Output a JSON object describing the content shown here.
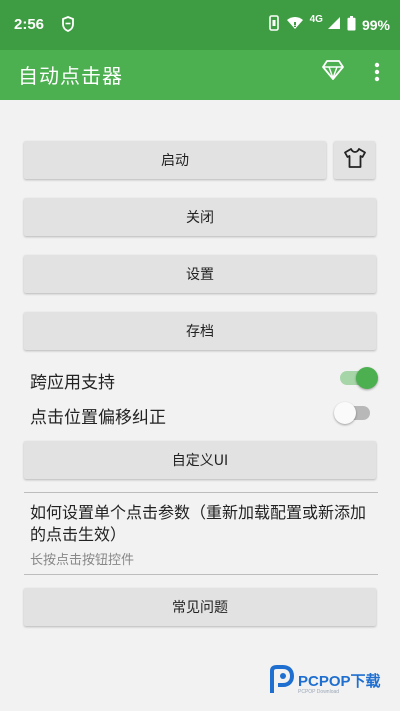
{
  "status_bar": {
    "time": "2:56",
    "network": "4G",
    "battery": "99%"
  },
  "app_bar": {
    "title": "自动点击器",
    "vip_icon": "diamond-icon",
    "menu_icon": "more-vert-icon"
  },
  "buttons": {
    "start": "启动",
    "stop": "关闭",
    "settings": "设置",
    "archive": "存档",
    "custom_ui": "自定义UI",
    "faq": "常见问题"
  },
  "skin_icon": "tshirt-icon",
  "toggles": [
    {
      "label": "跨应用支持",
      "on": true
    },
    {
      "label": "点击位置偏移纠正",
      "on": false
    }
  ],
  "help": {
    "title": "如何设置单个点击参数（重新加载配置或新添加的点击生效）",
    "subtitle": "长按点击按钮控件"
  },
  "watermark": {
    "brand": "PCPOP下载",
    "sub": "PCPOP Download"
  },
  "colors": {
    "status_bar": "#3e9d43",
    "app_bar": "#4caf50",
    "accent": "#4caf50"
  }
}
